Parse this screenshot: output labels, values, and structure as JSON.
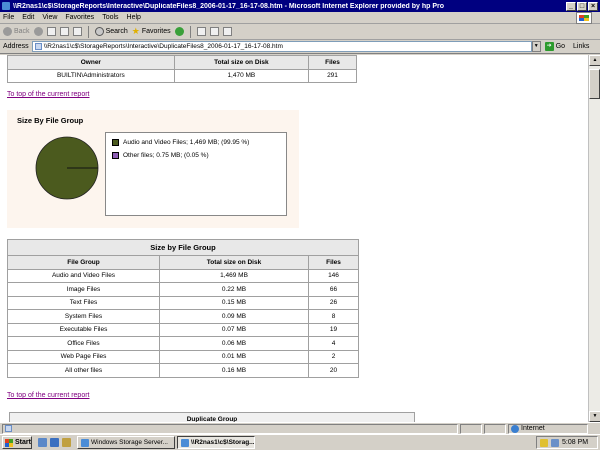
{
  "window": {
    "title": "\\\\R2nas1\\c$\\StorageReports\\Interactive\\DuplicateFiles8_2006-01-17_16-17-08.htm - Microsoft Internet Explorer provided by hp Pro"
  },
  "menu": [
    "File",
    "Edit",
    "View",
    "Favorites",
    "Tools",
    "Help"
  ],
  "toolbar": {
    "back": "Back",
    "search": "Search",
    "favorites": "Favorites"
  },
  "address": {
    "label": "Address",
    "value": "\\\\R2nas1\\c$\\StorageReports\\Interactive\\DuplicateFiles8_2006-01-17_16-17-08.htm",
    "go": "Go",
    "links": "Links"
  },
  "owner_table": {
    "headers": [
      "Owner",
      "Total size on Disk",
      "Files"
    ],
    "rows": [
      [
        "BUILTIN\\Administrators",
        "1,470 MB",
        "291"
      ]
    ]
  },
  "top_link": "To top of the current report",
  "pie": {
    "title": "Size By File Group",
    "legend": [
      {
        "label": "Audio and Video Files; 1,469 MB; (99.95 %)",
        "color": "#4b5a1e"
      },
      {
        "label": "Other files; 0.75 MB; (0.05 %)",
        "color": "#8e5fb4"
      }
    ]
  },
  "chart_data": {
    "type": "pie",
    "title": "Size By File Group",
    "categories": [
      "Audio and Video Files",
      "Other files"
    ],
    "values": [
      99.95,
      0.05
    ],
    "colors": [
      "#4b5a1e",
      "#8e5fb4"
    ]
  },
  "group_table": {
    "caption": "Size by File Group",
    "headers": [
      "File Group",
      "Total size on Disk",
      "Files"
    ],
    "rows": [
      [
        "Audio and Video Files",
        "1,469 MB",
        "146"
      ],
      [
        "Image Files",
        "0.22 MB",
        "66"
      ],
      [
        "Text Files",
        "0.15 MB",
        "26"
      ],
      [
        "System Files",
        "0.09 MB",
        "8"
      ],
      [
        "Executable Files",
        "0.07 MB",
        "19"
      ],
      [
        "Office Files",
        "0.06 MB",
        "4"
      ],
      [
        "Web Page Files",
        "0.01 MB",
        "2"
      ],
      [
        "All other files",
        "0.16 MB",
        "20"
      ]
    ]
  },
  "top_link_2": "To top of the current report",
  "dup_header": "Duplicate Group",
  "status": {
    "zone": "Internet"
  },
  "taskbar": {
    "start": "Start",
    "tasks": [
      "Windows Storage Server...",
      "\\\\R2nas1\\c$\\Storag..."
    ],
    "clock": "5:08 PM"
  }
}
